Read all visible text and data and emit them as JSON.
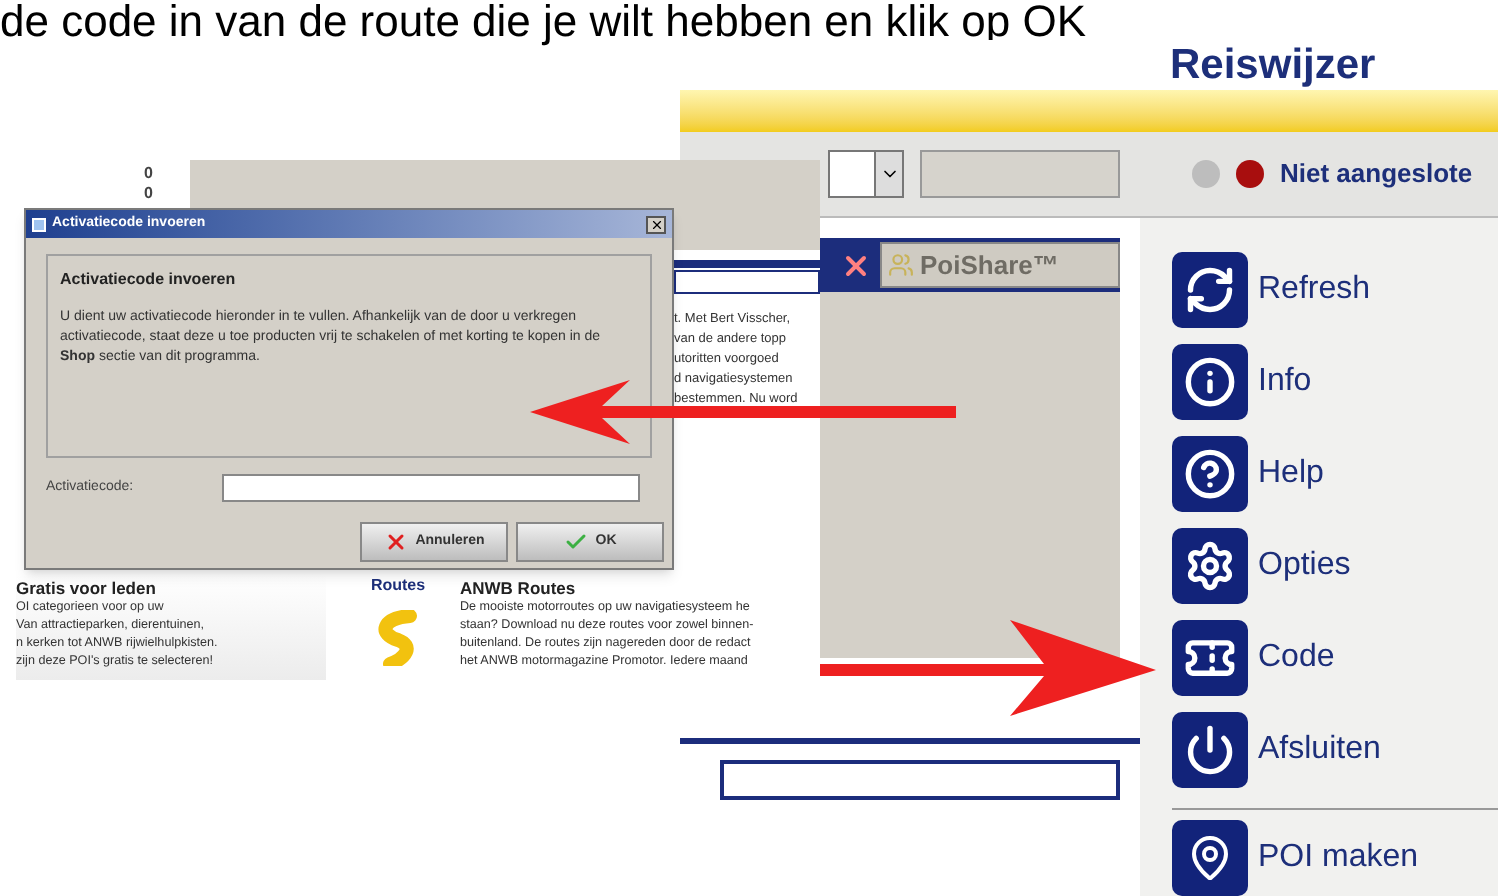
{
  "caption": "de code in van de route die je wilt hebben en klik op OK",
  "app": {
    "title": "Reiswijzer",
    "status": {
      "text": "Niet aangeslote",
      "connected": false
    },
    "poishare": "PoiShare™",
    "menu": [
      {
        "label": "Refresh",
        "kind": "refresh"
      },
      {
        "label": "Info",
        "kind": "info"
      },
      {
        "label": "Help",
        "kind": "help"
      },
      {
        "label": "Opties",
        "kind": "options"
      },
      {
        "label": "Code",
        "kind": "code"
      },
      {
        "label": "Afsluiten",
        "kind": "exit"
      }
    ],
    "poi_button": "POI maken"
  },
  "background_page": {
    "counters": [
      "0",
      "0"
    ],
    "snippet_lines": [
      "t. Met Bert Visscher,",
      "van de andere topp",
      "utoritten voorgoed",
      "d navigatiesystemen",
      "bestemmen. Nu word"
    ],
    "cards": [
      {
        "title": "Gratis voor leden",
        "lines": [
          "OI categorieen voor op uw",
          "Van attractieparken, dierentuinen,",
          "n kerken tot ANWB rijwielhulpkisten.",
          "zijn deze POI's gratis te selecteren!"
        ]
      },
      {
        "label": "Routes",
        "title": "ANWB Routes",
        "lines": [
          "De mooiste motorroutes op uw navigatiesysteem he",
          "staan? Download nu deze routes voor zowel binnen-",
          "buitenland. De routes zijn nagereden door de redact",
          "het ANWB motormagazine Promotor. Iedere maand"
        ]
      }
    ]
  },
  "dialog": {
    "title": "Activatiecode invoeren",
    "heading": "Activatiecode invoeren",
    "text": "U dient uw activatiecode hieronder in te vullen. Afhankelijk van de door u verkregen activatiecode, staat deze u toe producten vrij te schakelen of met korting te kopen in de **Shop** sectie van dit programma.",
    "field_label": "Activatiecode:",
    "buttons": [
      {
        "label": "Annuleren",
        "kind": "cancel"
      },
      {
        "label": "OK",
        "kind": "ok"
      }
    ]
  }
}
